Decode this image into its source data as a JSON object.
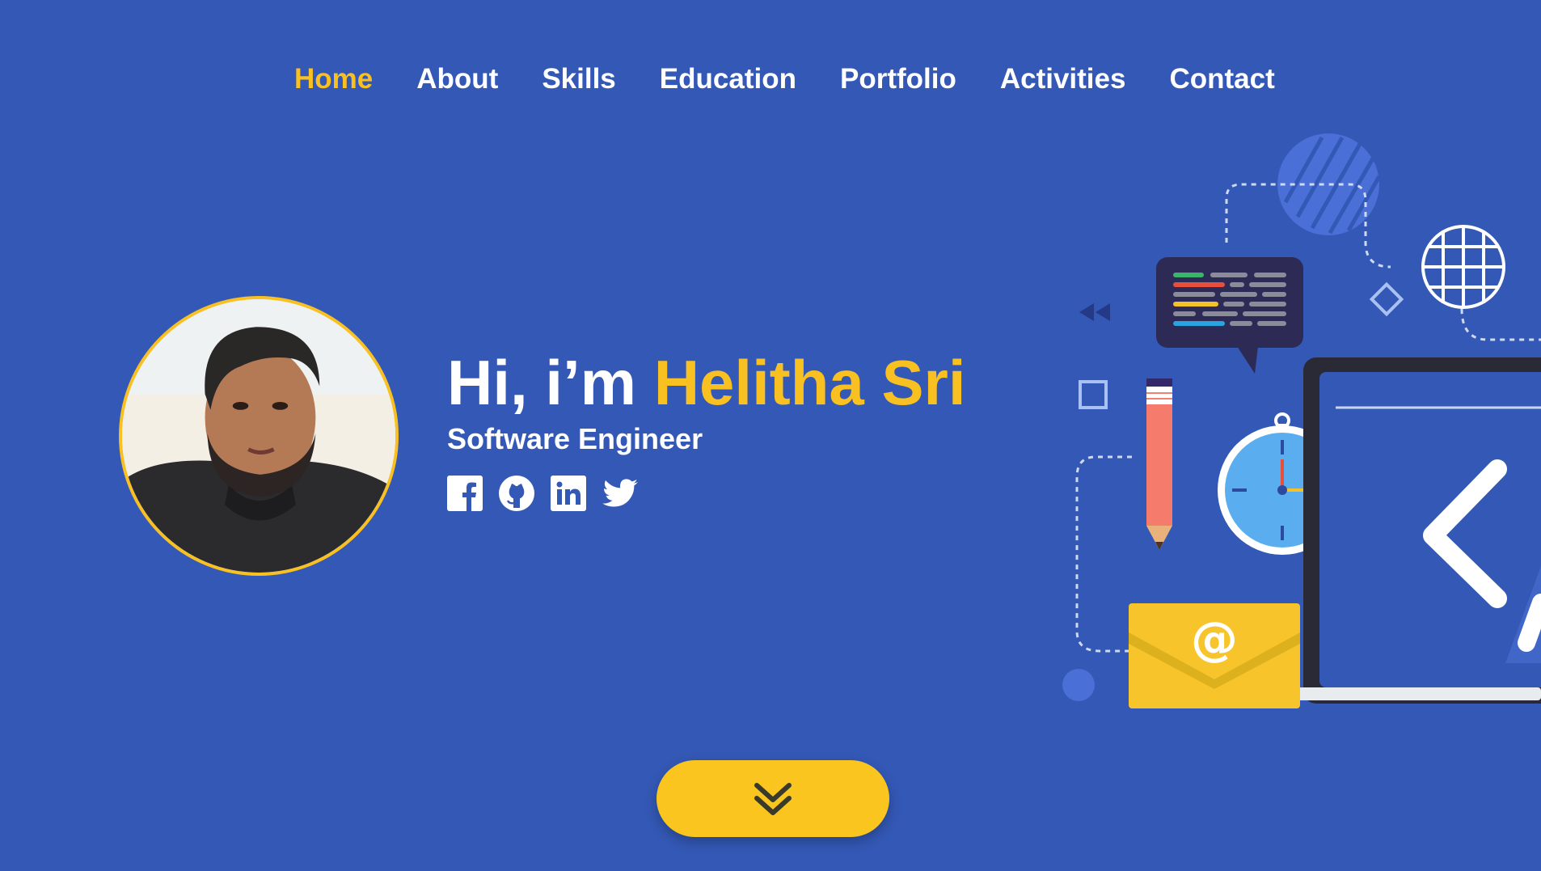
{
  "nav": {
    "items": [
      {
        "label": "Home",
        "active": true
      },
      {
        "label": "About",
        "active": false
      },
      {
        "label": "Skills",
        "active": false
      },
      {
        "label": "Education",
        "active": false
      },
      {
        "label": "Portfolio",
        "active": false
      },
      {
        "label": "Activities",
        "active": false
      },
      {
        "label": "Contact",
        "active": false
      }
    ]
  },
  "hero": {
    "greeting_prefix": "Hi, i’m ",
    "name": "Helitha Sri",
    "role": "Software Engineer",
    "socials": [
      {
        "icon": "facebook-icon"
      },
      {
        "icon": "github-icon"
      },
      {
        "icon": "linkedin-icon"
      },
      {
        "icon": "twitter-icon"
      }
    ]
  },
  "scroll_button": {
    "icon": "chevron-double-down-icon"
  },
  "colors": {
    "background": "#3358b5",
    "accent": "#f9c022",
    "text": "#ffffff"
  }
}
